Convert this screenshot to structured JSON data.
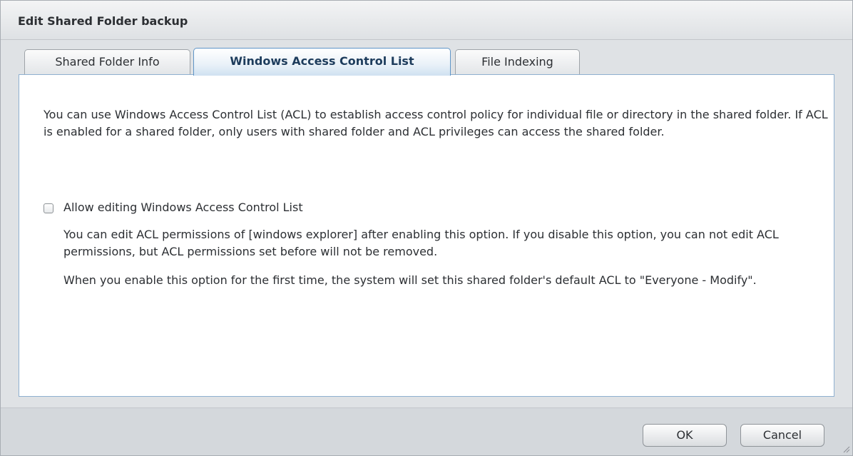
{
  "dialog": {
    "title": "Edit Shared Folder backup"
  },
  "tabs": [
    {
      "label": "Shared Folder Info",
      "active": false
    },
    {
      "label": "Windows Access Control List",
      "active": true
    },
    {
      "label": "File Indexing",
      "active": false
    }
  ],
  "panel": {
    "intro": "You can use Windows Access Control List (ACL) to establish access control policy for individual file or directory in the shared folder. If ACL is enabled for a shared folder, only users with shared folder and ACL privileges can access the shared folder.",
    "option": {
      "label": "Allow editing Windows Access Control List",
      "checked": false
    },
    "desc1": "You can edit ACL permissions of [windows explorer] after enabling this option. If you disable this option, you can not edit ACL permissions, but ACL permissions set before will not be removed.",
    "desc2": "When you enable this option for the first time, the system will set this shared folder's default ACL to \"Everyone - Modify\"."
  },
  "footer": {
    "ok_label": "OK",
    "cancel_label": "Cancel"
  }
}
